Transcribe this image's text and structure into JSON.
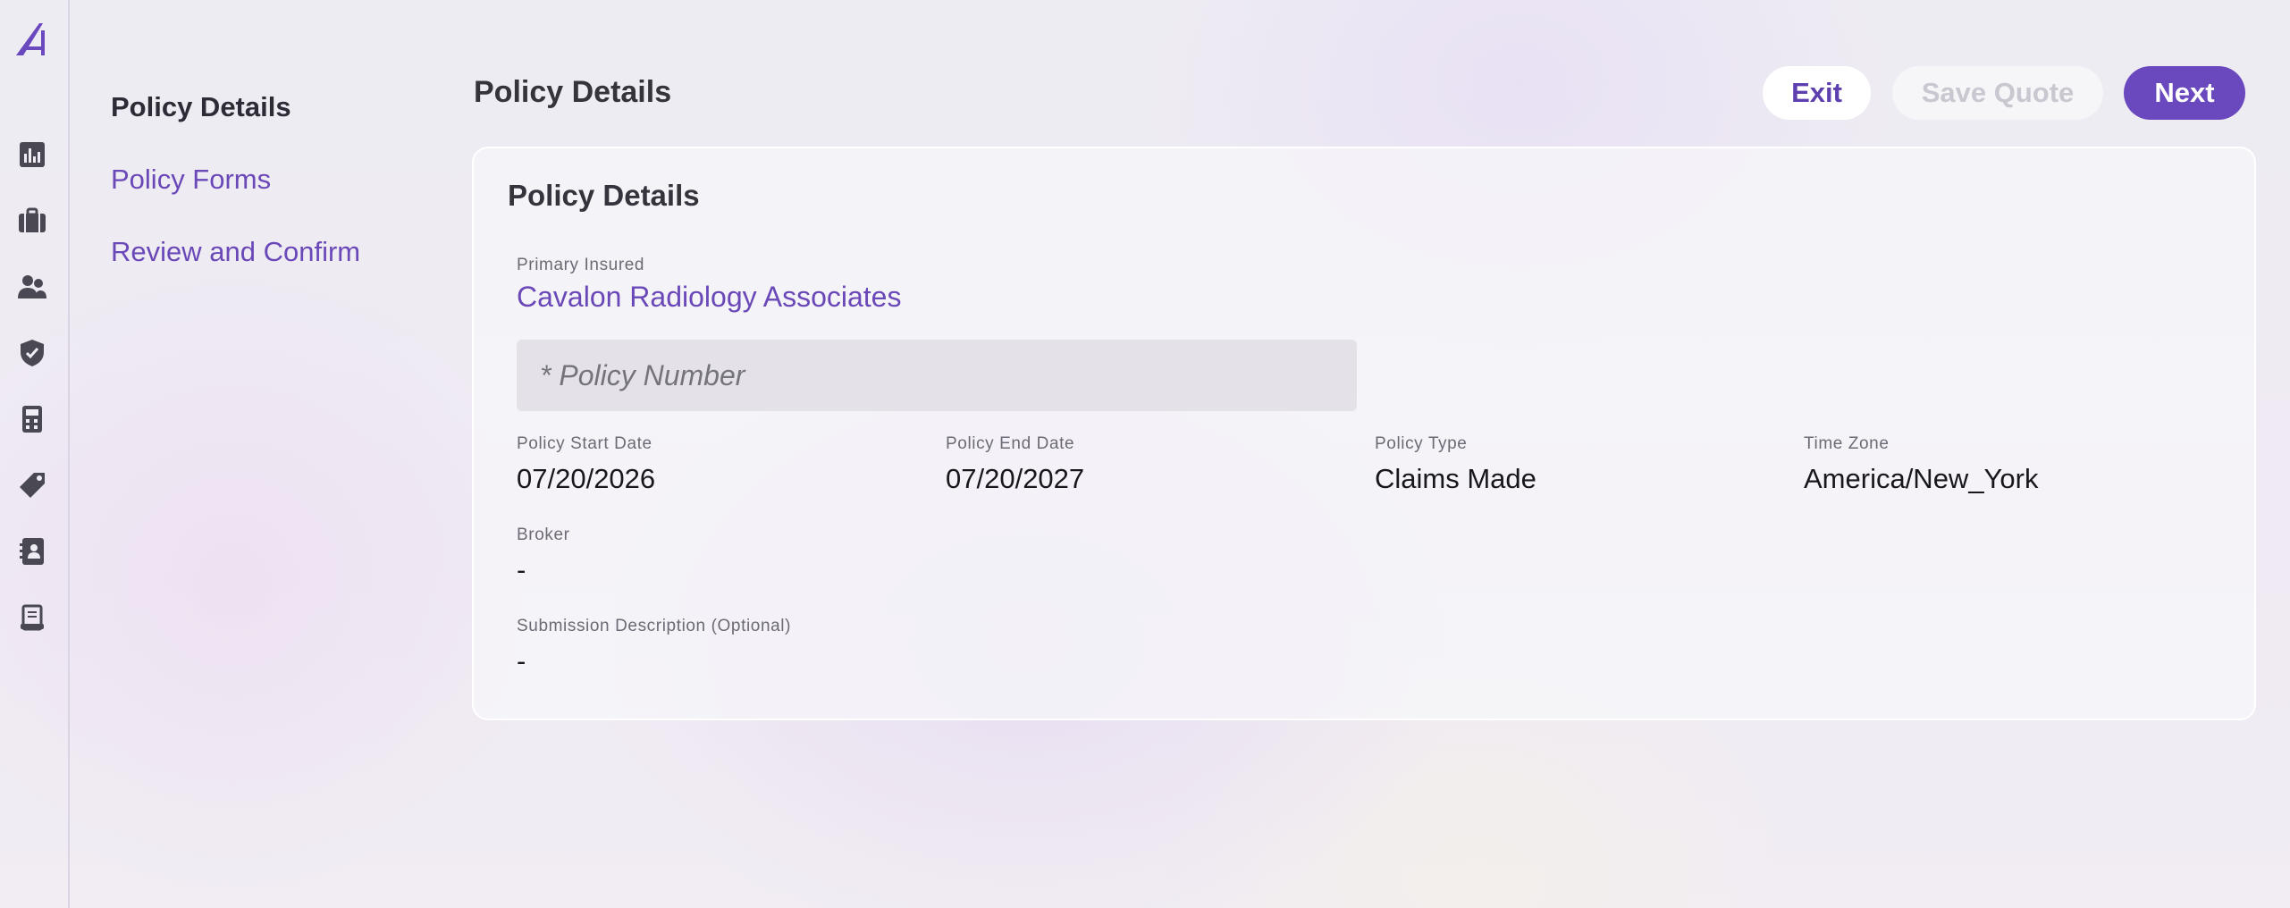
{
  "rail": {
    "icons": [
      "logo-icon",
      "chart-icon",
      "briefcase-icon",
      "users-icon",
      "shield-icon",
      "calculator-icon",
      "tag-icon",
      "contact-book-icon",
      "document-icon"
    ]
  },
  "steps": {
    "items": [
      {
        "label": "Policy Details",
        "active": true
      },
      {
        "label": "Policy Forms",
        "active": false
      },
      {
        "label": "Review and Confirm",
        "active": false
      }
    ]
  },
  "header": {
    "title": "Policy Details",
    "exit_label": "Exit",
    "save_label": "Save Quote",
    "next_label": "Next"
  },
  "card": {
    "title": "Policy Details",
    "primary_insured_label": "Primary Insured",
    "primary_insured_value": "Cavalon Radiology Associates",
    "policy_number_placeholder": "* Policy Number",
    "fields": {
      "start_date": {
        "label": "Policy Start Date",
        "value": "07/20/2026"
      },
      "end_date": {
        "label": "Policy End Date",
        "value": "07/20/2027"
      },
      "policy_type": {
        "label": "Policy Type",
        "value": "Claims Made"
      },
      "time_zone": {
        "label": "Time Zone",
        "value": "America/New_York"
      },
      "broker": {
        "label": "Broker",
        "value": "-"
      },
      "submission_description": {
        "label": "Submission Description (Optional)",
        "value": "-"
      }
    }
  },
  "colors": {
    "accent": "#6a49be",
    "link": "#6a48b8",
    "icon": "#4a4853"
  }
}
